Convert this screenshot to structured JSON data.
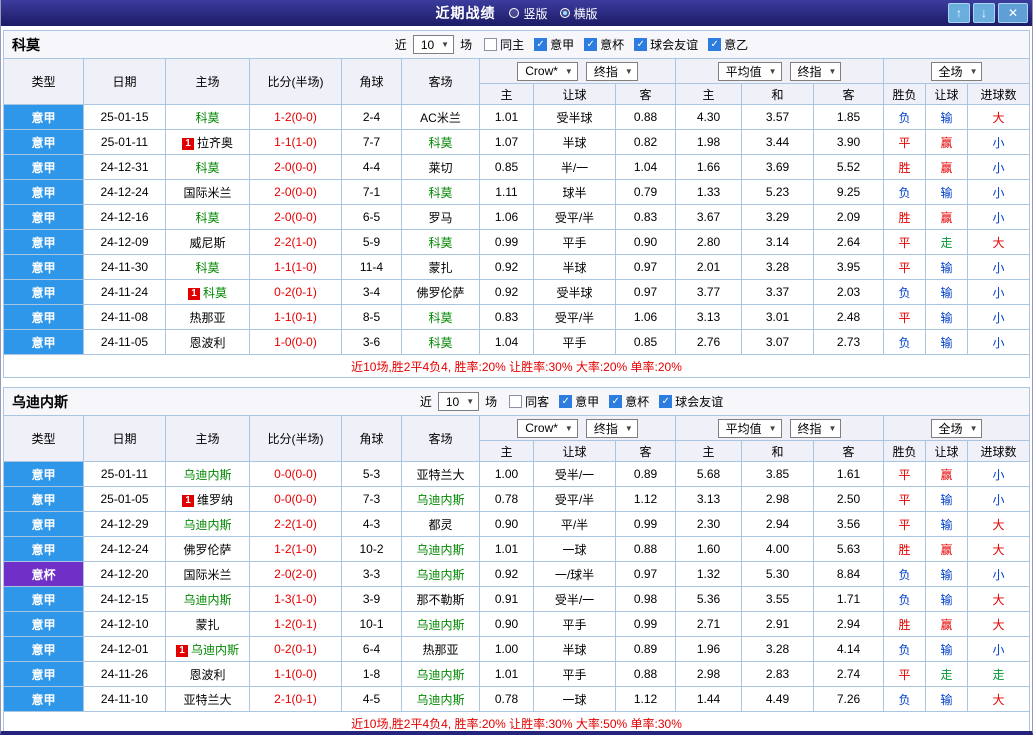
{
  "titlebar": {
    "title": "近期战绩",
    "radios": [
      {
        "label": "竖版",
        "selected": false
      },
      {
        "label": "横版",
        "selected": true
      }
    ],
    "up_icon": "↑",
    "down_icon": "↓",
    "close_icon": "✕"
  },
  "controls": {
    "near_label": "近",
    "near_value": "10",
    "games_label": "场",
    "crow_select": "Crow*",
    "final_select": "终指",
    "avg_select": "平均值",
    "fullmatch_select": "全场",
    "dropdown_icon": "▼"
  },
  "table_headers": {
    "col_type": "类型",
    "col_date": "日期",
    "col_home": "主场",
    "col_score": "比分(半场)",
    "col_corner": "角球",
    "col_away": "客场",
    "odds_home": "主",
    "odds_handicap": "让球",
    "odds_away": "客",
    "avg_home": "主",
    "avg_draw": "和",
    "avg_away": "客",
    "res_wdl": "胜负",
    "res_handicap": "让球",
    "res_goals": "进球数"
  },
  "card_badge": "1",
  "colors": {
    "league_colors": {
      "意甲": "#2e97ea",
      "意杯": "#7030c8"
    },
    "result_colors": {
      "red": "#e60000",
      "blue": "#0040cc",
      "green": "#009933"
    },
    "team_green": "#008800",
    "score_red": "#e60000",
    "summary_red": "#e60000",
    "titlebar_bg": "#24247c"
  },
  "sections": [
    {
      "team": "科莫",
      "filters": [
        {
          "label": "同主",
          "checked": false
        },
        {
          "label": "意甲",
          "checked": true
        },
        {
          "label": "意杯",
          "checked": true
        },
        {
          "label": "球会友谊",
          "checked": true
        },
        {
          "label": "意乙",
          "checked": true
        }
      ],
      "rows": [
        {
          "league": "意甲",
          "date": "25-01-15",
          "home": "科莫",
          "home_green": true,
          "score": "1-2(0-0)",
          "corners": "2-4",
          "away": "AC米兰",
          "odds": [
            "1.01",
            "受半球",
            "0.88"
          ],
          "avg_odds": [
            "4.30",
            "3.57",
            "1.85"
          ],
          "results": [
            [
              "负",
              "blue"
            ],
            [
              "输",
              "blue"
            ],
            [
              "大",
              "red"
            ]
          ]
        },
        {
          "league": "意甲",
          "date": "25-01-11",
          "home": "拉齐奥",
          "home_card": true,
          "score": "1-1(1-0)",
          "corners": "7-7",
          "away": "科莫",
          "away_green": true,
          "odds": [
            "1.07",
            "半球",
            "0.82"
          ],
          "avg_odds": [
            "1.98",
            "3.44",
            "3.90"
          ],
          "results": [
            [
              "平",
              "red"
            ],
            [
              "赢",
              "red"
            ],
            [
              "小",
              "blue"
            ]
          ]
        },
        {
          "league": "意甲",
          "date": "24-12-31",
          "home": "科莫",
          "home_green": true,
          "score": "2-0(0-0)",
          "corners": "4-4",
          "away": "莱切",
          "odds": [
            "0.85",
            "半/一",
            "1.04"
          ],
          "avg_odds": [
            "1.66",
            "3.69",
            "5.52"
          ],
          "results": [
            [
              "胜",
              "red"
            ],
            [
              "赢",
              "red"
            ],
            [
              "小",
              "blue"
            ]
          ]
        },
        {
          "league": "意甲",
          "date": "24-12-24",
          "home": "国际米兰",
          "score": "2-0(0-0)",
          "corners": "7-1",
          "away": "科莫",
          "away_green": true,
          "odds": [
            "1.11",
            "球半",
            "0.79"
          ],
          "avg_odds": [
            "1.33",
            "5.23",
            "9.25"
          ],
          "results": [
            [
              "负",
              "blue"
            ],
            [
              "输",
              "blue"
            ],
            [
              "小",
              "blue"
            ]
          ]
        },
        {
          "league": "意甲",
          "date": "24-12-16",
          "home": "科莫",
          "home_green": true,
          "score": "2-0(0-0)",
          "corners": "6-5",
          "away": "罗马",
          "odds": [
            "1.06",
            "受平/半",
            "0.83"
          ],
          "avg_odds": [
            "3.67",
            "3.29",
            "2.09"
          ],
          "results": [
            [
              "胜",
              "red"
            ],
            [
              "赢",
              "red"
            ],
            [
              "小",
              "blue"
            ]
          ]
        },
        {
          "league": "意甲",
          "date": "24-12-09",
          "home": "威尼斯",
          "score": "2-2(1-0)",
          "corners": "5-9",
          "away": "科莫",
          "away_green": true,
          "odds": [
            "0.99",
            "平手",
            "0.90"
          ],
          "avg_odds": [
            "2.80",
            "3.14",
            "2.64"
          ],
          "results": [
            [
              "平",
              "red"
            ],
            [
              "走",
              "green"
            ],
            [
              "大",
              "red"
            ]
          ]
        },
        {
          "league": "意甲",
          "date": "24-11-30",
          "home": "科莫",
          "home_green": true,
          "score": "1-1(1-0)",
          "corners": "11-4",
          "away": "蒙扎",
          "odds": [
            "0.92",
            "半球",
            "0.97"
          ],
          "avg_odds": [
            "2.01",
            "3.28",
            "3.95"
          ],
          "results": [
            [
              "平",
              "red"
            ],
            [
              "输",
              "blue"
            ],
            [
              "小",
              "blue"
            ]
          ]
        },
        {
          "league": "意甲",
          "date": "24-11-24",
          "home": "科莫",
          "home_green": true,
          "home_card": true,
          "score": "0-2(0-1)",
          "corners": "3-4",
          "away": "佛罗伦萨",
          "odds": [
            "0.92",
            "受半球",
            "0.97"
          ],
          "avg_odds": [
            "3.77",
            "3.37",
            "2.03"
          ],
          "results": [
            [
              "负",
              "blue"
            ],
            [
              "输",
              "blue"
            ],
            [
              "小",
              "blue"
            ]
          ]
        },
        {
          "league": "意甲",
          "date": "24-11-08",
          "home": "热那亚",
          "score": "1-1(0-1)",
          "corners": "8-5",
          "away": "科莫",
          "away_green": true,
          "odds": [
            "0.83",
            "受平/半",
            "1.06"
          ],
          "avg_odds": [
            "3.13",
            "3.01",
            "2.48"
          ],
          "results": [
            [
              "平",
              "red"
            ],
            [
              "输",
              "blue"
            ],
            [
              "小",
              "blue"
            ]
          ]
        },
        {
          "league": "意甲",
          "date": "24-11-05",
          "home": "恩波利",
          "score": "1-0(0-0)",
          "corners": "3-6",
          "away": "科莫",
          "away_green": true,
          "odds": [
            "1.04",
            "平手",
            "0.85"
          ],
          "avg_odds": [
            "2.76",
            "3.07",
            "2.73"
          ],
          "results": [
            [
              "负",
              "blue"
            ],
            [
              "输",
              "blue"
            ],
            [
              "小",
              "blue"
            ]
          ]
        }
      ],
      "summary": "近10场,胜2平4负4, 胜率:20% 让胜率:30% 大率:20% 单率:20%"
    },
    {
      "team": "乌迪内斯",
      "filters": [
        {
          "label": "同客",
          "checked": false
        },
        {
          "label": "意甲",
          "checked": true
        },
        {
          "label": "意杯",
          "checked": true
        },
        {
          "label": "球会友谊",
          "checked": true
        }
      ],
      "rows": [
        {
          "league": "意甲",
          "date": "25-01-11",
          "home": "乌迪内斯",
          "home_green": true,
          "score": "0-0(0-0)",
          "corners": "5-3",
          "away": "亚特兰大",
          "odds": [
            "1.00",
            "受半/一",
            "0.89"
          ],
          "avg_odds": [
            "5.68",
            "3.85",
            "1.61"
          ],
          "results": [
            [
              "平",
              "red"
            ],
            [
              "赢",
              "red"
            ],
            [
              "小",
              "blue"
            ]
          ]
        },
        {
          "league": "意甲",
          "date": "25-01-05",
          "home": "维罗纳",
          "home_card": true,
          "score": "0-0(0-0)",
          "corners": "7-3",
          "away": "乌迪内斯",
          "away_green": true,
          "odds": [
            "0.78",
            "受平/半",
            "1.12"
          ],
          "avg_odds": [
            "3.13",
            "2.98",
            "2.50"
          ],
          "results": [
            [
              "平",
              "red"
            ],
            [
              "输",
              "blue"
            ],
            [
              "小",
              "blue"
            ]
          ]
        },
        {
          "league": "意甲",
          "date": "24-12-29",
          "home": "乌迪内斯",
          "home_green": true,
          "score": "2-2(1-0)",
          "corners": "4-3",
          "away": "都灵",
          "odds": [
            "0.90",
            "平/半",
            "0.99"
          ],
          "avg_odds": [
            "2.30",
            "2.94",
            "3.56"
          ],
          "results": [
            [
              "平",
              "red"
            ],
            [
              "输",
              "blue"
            ],
            [
              "大",
              "red"
            ]
          ]
        },
        {
          "league": "意甲",
          "date": "24-12-24",
          "home": "佛罗伦萨",
          "score": "1-2(1-0)",
          "corners": "10-2",
          "away": "乌迪内斯",
          "away_green": true,
          "odds": [
            "1.01",
            "一球",
            "0.88"
          ],
          "avg_odds": [
            "1.60",
            "4.00",
            "5.63"
          ],
          "results": [
            [
              "胜",
              "red"
            ],
            [
              "赢",
              "red"
            ],
            [
              "大",
              "red"
            ]
          ]
        },
        {
          "league": "意杯",
          "date": "24-12-20",
          "home": "国际米兰",
          "score": "2-0(2-0)",
          "corners": "3-3",
          "away": "乌迪内斯",
          "away_green": true,
          "odds": [
            "0.92",
            "一/球半",
            "0.97"
          ],
          "avg_odds": [
            "1.32",
            "5.30",
            "8.84"
          ],
          "results": [
            [
              "负",
              "blue"
            ],
            [
              "输",
              "blue"
            ],
            [
              "小",
              "blue"
            ]
          ]
        },
        {
          "league": "意甲",
          "date": "24-12-15",
          "home": "乌迪内斯",
          "home_green": true,
          "score": "1-3(1-0)",
          "corners": "3-9",
          "away": "那不勒斯",
          "odds": [
            "0.91",
            "受半/一",
            "0.98"
          ],
          "avg_odds": [
            "5.36",
            "3.55",
            "1.71"
          ],
          "results": [
            [
              "负",
              "blue"
            ],
            [
              "输",
              "blue"
            ],
            [
              "大",
              "red"
            ]
          ]
        },
        {
          "league": "意甲",
          "date": "24-12-10",
          "home": "蒙扎",
          "score": "1-2(0-1)",
          "corners": "10-1",
          "away": "乌迪内斯",
          "away_green": true,
          "odds": [
            "0.90",
            "平手",
            "0.99"
          ],
          "avg_odds": [
            "2.71",
            "2.91",
            "2.94"
          ],
          "results": [
            [
              "胜",
              "red"
            ],
            [
              "赢",
              "red"
            ],
            [
              "大",
              "red"
            ]
          ]
        },
        {
          "league": "意甲",
          "date": "24-12-01",
          "home": "乌迪内斯",
          "home_green": true,
          "home_card": true,
          "score": "0-2(0-1)",
          "corners": "6-4",
          "away": "热那亚",
          "odds": [
            "1.00",
            "半球",
            "0.89"
          ],
          "avg_odds": [
            "1.96",
            "3.28",
            "4.14"
          ],
          "results": [
            [
              "负",
              "blue"
            ],
            [
              "输",
              "blue"
            ],
            [
              "小",
              "blue"
            ]
          ]
        },
        {
          "league": "意甲",
          "date": "24-11-26",
          "home": "恩波利",
          "score": "1-1(0-0)",
          "corners": "1-8",
          "away": "乌迪内斯",
          "away_green": true,
          "odds": [
            "1.01",
            "平手",
            "0.88"
          ],
          "avg_odds": [
            "2.98",
            "2.83",
            "2.74"
          ],
          "results": [
            [
              "平",
              "red"
            ],
            [
              "走",
              "green"
            ],
            [
              "走",
              "green"
            ]
          ]
        },
        {
          "league": "意甲",
          "date": "24-11-10",
          "home": "亚特兰大",
          "score": "2-1(0-1)",
          "corners": "4-5",
          "away": "乌迪内斯",
          "away_green": true,
          "odds": [
            "0.78",
            "一球",
            "1.12"
          ],
          "avg_odds": [
            "1.44",
            "4.49",
            "7.26"
          ],
          "results": [
            [
              "负",
              "blue"
            ],
            [
              "输",
              "blue"
            ],
            [
              "大",
              "red"
            ]
          ]
        }
      ],
      "summary": "近10场,胜2平4负4, 胜率:20% 让胜率:30% 大率:50% 单率:30%"
    }
  ]
}
